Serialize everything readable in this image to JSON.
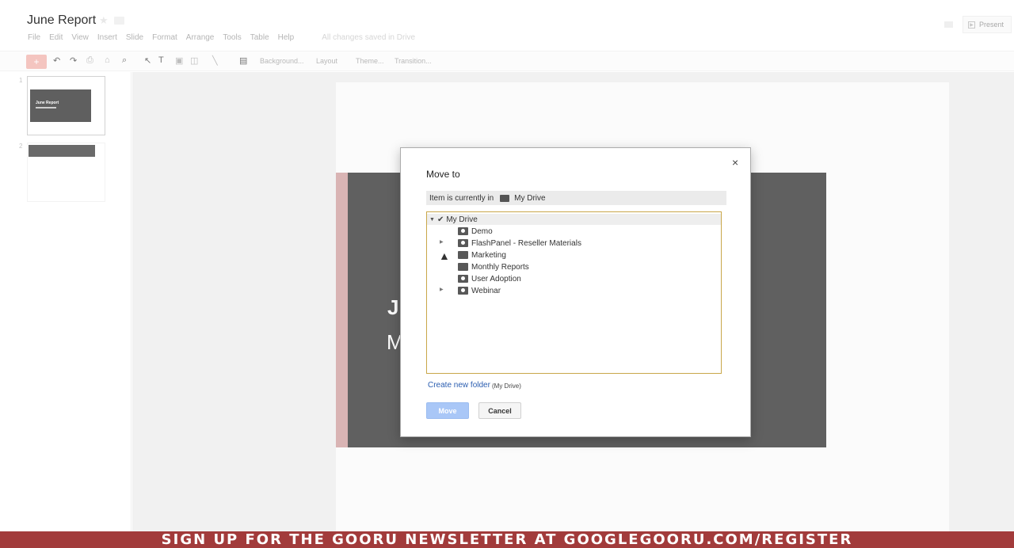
{
  "document": {
    "title": "June Report"
  },
  "menu": {
    "items": [
      "File",
      "Edit",
      "View",
      "Insert",
      "Slide",
      "Format",
      "Arrange",
      "Tools",
      "Table",
      "Help"
    ],
    "status": "All changes saved in Drive"
  },
  "header": {
    "present_label": "Present"
  },
  "toolbar": {
    "add_label": "+",
    "background_label": "Background...",
    "layout_label": "Layout",
    "theme_label": "Theme...",
    "transition_label": "Transition..."
  },
  "filmstrip": {
    "slides": [
      {
        "number": "1",
        "title": "June Report"
      },
      {
        "number": "2"
      }
    ]
  },
  "slide": {
    "title_peek": "J",
    "subtitle_peek": "M"
  },
  "dialog": {
    "title": "Move to",
    "close_label": "×",
    "location_prefix": "Item is currently in",
    "location_folder": "My Drive",
    "tree": {
      "root": "My Drive",
      "folders": [
        {
          "name": "Demo",
          "expandable": false,
          "shared": true
        },
        {
          "name": "FlashPanel - Reseller Materials",
          "expandable": true,
          "shared": true
        },
        {
          "name": "Marketing",
          "expandable": false,
          "shared": false
        },
        {
          "name": "Monthly Reports",
          "expandable": false,
          "shared": false
        },
        {
          "name": "User Adoption",
          "expandable": false,
          "shared": true
        },
        {
          "name": "Webinar",
          "expandable": true,
          "shared": true
        }
      ]
    },
    "create_folder_label": "Create new folder",
    "create_folder_note": "(My Drive)",
    "move_label": "Move",
    "cancel_label": "Cancel"
  },
  "banner": {
    "text": "SIGN UP FOR THE GOORU NEWSLETTER AT GOOGLEGOORU.COM/REGISTER"
  },
  "colors": {
    "accent": "#a23b3b",
    "link": "#2a5db0",
    "move_button": "#a9c7f7",
    "tree_border": "#c9a74a"
  }
}
